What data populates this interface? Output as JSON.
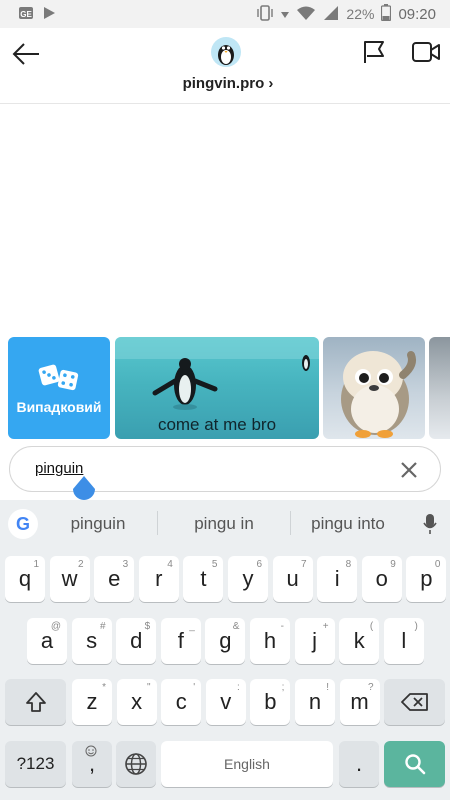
{
  "status_bar": {
    "battery": "22%",
    "time": "09:20"
  },
  "header": {
    "channel_name": "pingvin.pro ›"
  },
  "gifs": {
    "random_label": "Випадковий",
    "ice_caption": "come at me bro"
  },
  "search": {
    "value": "pinguin"
  },
  "keyboard": {
    "suggestions": [
      "pinguin",
      "pingu in",
      "pingu into"
    ],
    "row1": [
      {
        "label": "q",
        "hint": "1"
      },
      {
        "label": "w",
        "hint": "2"
      },
      {
        "label": "e",
        "hint": "3"
      },
      {
        "label": "r",
        "hint": "4"
      },
      {
        "label": "t",
        "hint": "5"
      },
      {
        "label": "y",
        "hint": "6"
      },
      {
        "label": "u",
        "hint": "7"
      },
      {
        "label": "i",
        "hint": "8"
      },
      {
        "label": "o",
        "hint": "9"
      },
      {
        "label": "p",
        "hint": "0"
      }
    ],
    "row2": [
      {
        "label": "a",
        "hint": "@"
      },
      {
        "label": "s",
        "hint": "#"
      },
      {
        "label": "d",
        "hint": "$"
      },
      {
        "label": "f",
        "hint": "_"
      },
      {
        "label": "g",
        "hint": "&"
      },
      {
        "label": "h",
        "hint": "-"
      },
      {
        "label": "j",
        "hint": "+"
      },
      {
        "label": "k",
        "hint": "("
      },
      {
        "label": "l",
        "hint": ")"
      }
    ],
    "row3": [
      {
        "label": "z",
        "hint": "*"
      },
      {
        "label": "x",
        "hint": "\""
      },
      {
        "label": "c",
        "hint": "'"
      },
      {
        "label": "v",
        "hint": ":"
      },
      {
        "label": "b",
        "hint": ";"
      },
      {
        "label": "n",
        "hint": "!"
      },
      {
        "label": "m",
        "hint": "?"
      }
    ],
    "symbols_label": "?123",
    "comma_label": ",",
    "space_label": "English",
    "period_label": "."
  },
  "colors": {
    "accent_blue": "#35a7f1",
    "search_key": "#5bb59e",
    "keyboard_bg": "#eceff1"
  },
  "icons": [
    "back-arrow-icon",
    "penguin-avatar-icon",
    "flag-icon",
    "video-camera-icon",
    "dice-icon",
    "clear-icon",
    "google-icon",
    "microphone-icon",
    "shift-icon",
    "backspace-icon",
    "emoji-icon",
    "globe-icon",
    "search-icon"
  ]
}
